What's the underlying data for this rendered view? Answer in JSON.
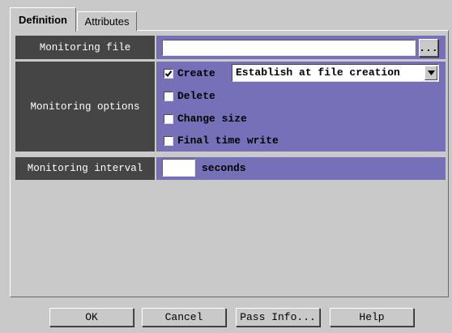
{
  "tabs": [
    {
      "label": "Definition",
      "active": true
    },
    {
      "label": "Attributes",
      "active": false
    }
  ],
  "monitoring_file": {
    "label": "Monitoring file",
    "value": "",
    "browse_label": "..."
  },
  "monitoring_options": {
    "label": "Monitoring options",
    "create": {
      "label": "Create",
      "checked": true
    },
    "create_mode": {
      "selected": "Establish at file creation"
    },
    "delete": {
      "label": "Delete",
      "checked": false
    },
    "change_size": {
      "label": "Change size",
      "checked": false
    },
    "final_time_write": {
      "label": "Final time write",
      "checked": false
    }
  },
  "monitoring_interval": {
    "label": "Monitoring interval",
    "value": "",
    "unit": "seconds"
  },
  "buttons": {
    "ok": "OK",
    "cancel": "Cancel",
    "pass_info": "Pass Info...",
    "help": "Help"
  },
  "colors": {
    "label_bg": "#454545",
    "option_bg": "#7570b8",
    "window_bg": "#c9c9c9"
  },
  "icons": {
    "checkbox_checked": "check-icon",
    "dropdown": "triangle-down-icon"
  }
}
